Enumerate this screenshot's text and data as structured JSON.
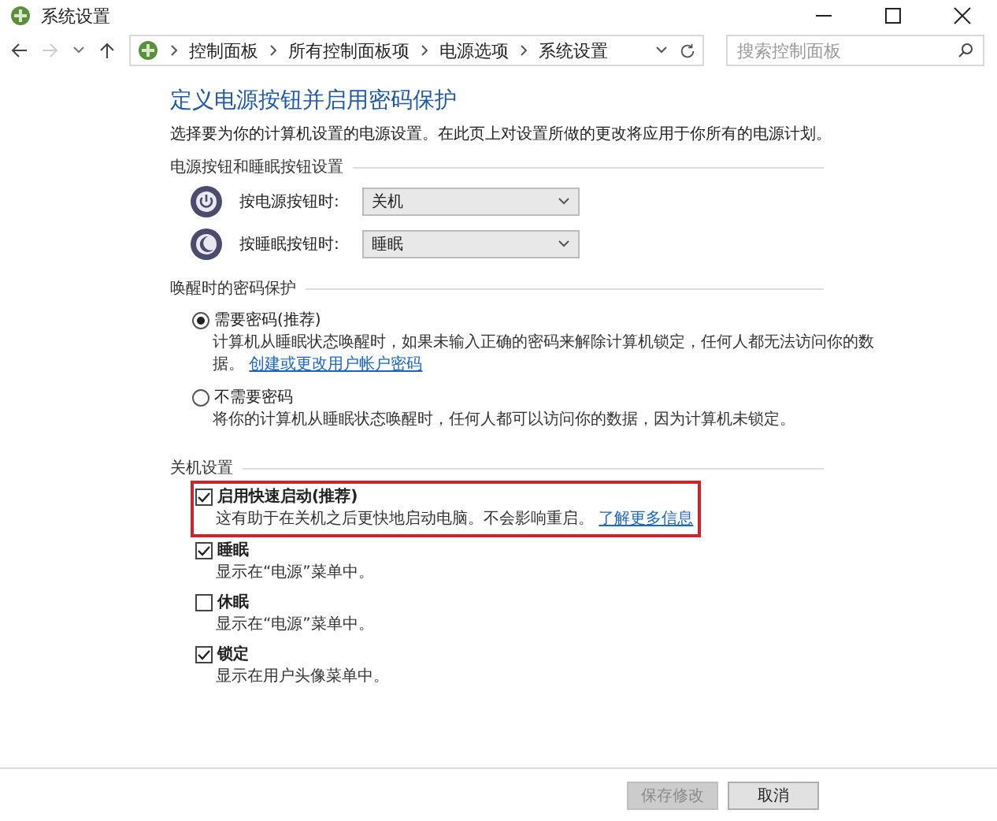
{
  "window": {
    "title": "系统设置"
  },
  "address_bar": {
    "breadcrumbs": [
      "控制面板",
      "所有控制面板项",
      "电源选项",
      "系统设置"
    ]
  },
  "search": {
    "placeholder": "搜索控制面板"
  },
  "heading": "定义电源按钮并启用密码保护",
  "description": "选择要为你的计算机设置的电源设置。在此页上对设置所做的更改将应用于你所有的电源计划。",
  "power_buttons": {
    "title": "电源按钮和睡眠按钮设置",
    "rows": [
      {
        "kind": "power",
        "label": "按电源按钮时:",
        "value": "关机"
      },
      {
        "kind": "sleep",
        "label": "按睡眠按钮时:",
        "value": "睡眠"
      }
    ]
  },
  "wake_password": {
    "title": "唤醒时的密码保护",
    "options": [
      {
        "label": "需要密码(推荐)",
        "selected": true,
        "description": "计算机从睡眠状态唤醒时，如果未输入正确的密码来解除计算机锁定，任何人都无法访问你的数据。",
        "link": "创建或更改用户帐户密码"
      },
      {
        "label": "不需要密码",
        "selected": false,
        "description": "将你的计算机从睡眠状态唤醒时，任何人都可以访问你的数据，因为计算机未锁定。"
      }
    ]
  },
  "shutdown": {
    "title": "关机设置",
    "options": [
      {
        "label": "启用快速启动(推荐)",
        "checked": true,
        "highlighted": true,
        "description": "这有助于在关机之后更快地启动电脑。不会影响重启。",
        "link": "了解更多信息"
      },
      {
        "label": "睡眠",
        "checked": true,
        "highlighted": false,
        "description": "显示在“电源”菜单中。"
      },
      {
        "label": "休眠",
        "checked": false,
        "highlighted": false,
        "description": "显示在“电源”菜单中。"
      },
      {
        "label": "锁定",
        "checked": true,
        "highlighted": false,
        "description": "显示在用户头像菜单中。"
      }
    ]
  },
  "buttons": [
    {
      "label": "保存修改",
      "disabled": true
    },
    {
      "label": "取消",
      "disabled": false
    }
  ]
}
